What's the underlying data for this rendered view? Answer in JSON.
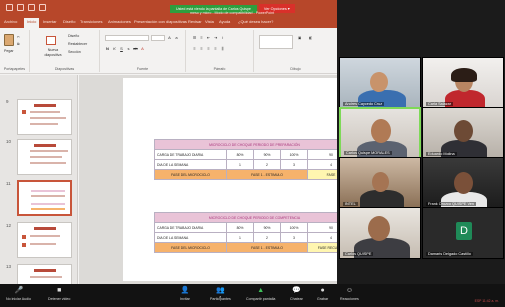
{
  "powerpoint": {
    "doc_title": "meso y micro - Modo de compatibilidad - PowerPoint",
    "share_notice": "Usted está viendo la pantalla de Carlos Quispe",
    "share_options": "Ver Opciones ▾",
    "tabs": [
      "Archivo",
      "Inicio",
      "Insertar",
      "Diseño",
      "Transiciones",
      "Animaciones",
      "Presentación con diapositivas",
      "Revisar",
      "Vista",
      "Ayuda",
      "¿Qué desea hacer?"
    ],
    "active_tab": "Inicio",
    "ribbon": {
      "groups": [
        "Portapapeles",
        "Diapositivas",
        "Fuente",
        "Párrafo",
        "Dibujo"
      ],
      "paste": "Pegar",
      "new_slide": "Nueva diapositiva",
      "layout": "Diseño",
      "reset": "Restablecer",
      "section": "Sección"
    },
    "thumbnails": [
      {
        "number": "9"
      },
      {
        "number": "10"
      },
      {
        "number": "11"
      },
      {
        "number": "12"
      },
      {
        "number": "13"
      }
    ],
    "slide": {
      "table1": {
        "title": "MICROCICLO DE CHOQUE PERIODO DE PREPARACIÓN",
        "rows": [
          {
            "label": "CARGA DE TRABAJO DIARIA",
            "cells": [
              "80%",
              "90%",
              "100%",
              "90"
            ]
          },
          {
            "label": "DIA DE LA SEMANA",
            "cells": [
              "1",
              "2",
              "3",
              "4"
            ]
          }
        ],
        "phase_label": "FASE DEL MICROCICLO",
        "phase_1": "FASE 1 - ESTIMULO",
        "phase_2": "FASE"
      },
      "table2": {
        "title": "MICROCICLO DE CHOQUE PERIODO DE COMPETENCIA",
        "rows": [
          {
            "label": "CARGA DE TRABAJO DIARIA",
            "cells": [
              "80%",
              "90%",
              "100%",
              "90"
            ]
          },
          {
            "label": "DIA DE LA SEMANA",
            "cells": [
              "1",
              "2",
              "3",
              "4"
            ]
          }
        ],
        "phase_label": "FASE DEL MICROCICLO",
        "phase_1": "FASE 1 - ESTIMULO",
        "phase_2": "FASE RECUPER"
      }
    }
  },
  "participants": [
    {
      "name": "Andres Caycedo Cruz"
    },
    {
      "name": "Carla Salazar"
    },
    {
      "name": "Carlos Quispe MORALES"
    },
    {
      "name": "Eduardo Molina"
    },
    {
      "name": "INTEL"
    },
    {
      "name": "Frank Orozco QUISPE Ven"
    },
    {
      "name": "Carlos QUISPE"
    },
    {
      "name": "Damaris Delgado Castillo",
      "initial": "D"
    }
  ],
  "statusbar": {
    "items": [
      {
        "label": "No iniciar Audio",
        "icon": "🎤"
      },
      {
        "label": "Detener video",
        "icon": "■"
      },
      {
        "label": "Invitar",
        "icon": "👤"
      },
      {
        "label": "Participantes",
        "icon": "👥",
        "count": "8"
      },
      {
        "label": "Compartir pantalla",
        "icon": "▲"
      },
      {
        "label": "Chatear",
        "icon": "💬"
      },
      {
        "label": "Grabar",
        "icon": "●"
      },
      {
        "label": "Reacciones",
        "icon": "☺"
      }
    ],
    "tray_text": "ESP 11:42 a. m."
  },
  "colors": {
    "ppt_red": "#b7472a",
    "share_green": "#2e9e3e",
    "header_pink": "#e9c3d7",
    "phase_orange": "#f6b26b",
    "active_speaker": "#7ed957"
  }
}
